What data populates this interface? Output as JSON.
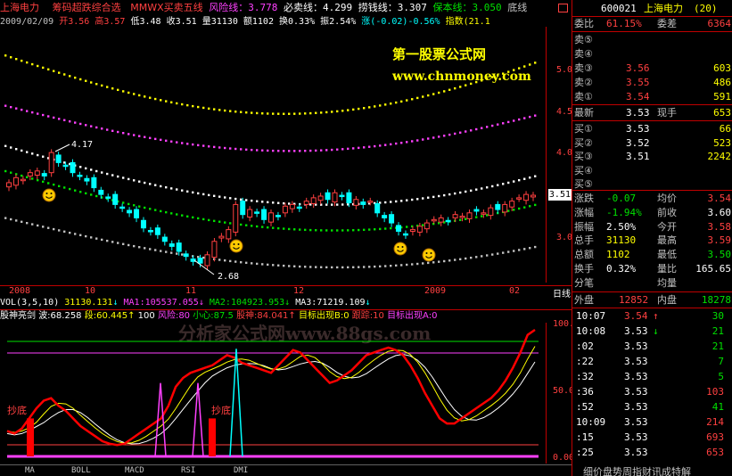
{
  "header": {
    "stock_name": "上海电力",
    "indicator_name": "筹码超跌综合选",
    "indicator_2": "MMWX买卖五线",
    "risk_line_label": "风险线：",
    "risk_line_val": "3.778",
    "sell_label": "必卖线：",
    "sell_val": "4.299",
    "scoop_label": "捞钱线：",
    "scoop_val": "3.307",
    "keep_label": "保本线：",
    "keep_val": "3.050",
    "bottom_label": "底线"
  },
  "ohlc": {
    "date": "2009/02/09",
    "open_label": "开",
    "open": "3.56",
    "high_label": "高",
    "high": "3.57",
    "low_label": "低",
    "low": "3.48",
    "close_label": "收",
    "close": "3.51",
    "vol_label": "量",
    "vol": "31130",
    "amt_label": "额",
    "amt": "1102",
    "turn_label": "换",
    "turn": "0.33%",
    "amp_label": "振",
    "amp": "2.54%",
    "chg_label": "涨",
    "chg": "(-0.02)-0.56%",
    "idx_label": "指数",
    "idx": "(21.1"
  },
  "watermark": {
    "site_name": "第一股票公式网",
    "site_url": "www.chnmoney.com"
  },
  "price_axis": {
    "p500": "5.00",
    "p450": "4.50",
    "p400": "4.00",
    "p350": "3.50",
    "p300": "3.00",
    "current": "3.51"
  },
  "annotations": {
    "high_mark": "4.17",
    "low_mark": "2.68"
  },
  "time_axis": {
    "t2008": "2008",
    "t10": "10",
    "t11": "11",
    "t12": "12",
    "t2009": "2009",
    "t02": "02",
    "period": "日线"
  },
  "vol_line": {
    "label": "VOL(3,5,10)",
    "vol": "31130.131",
    "ma1": "MA1:105537.055",
    "ma2": "MA2:104923.953",
    "ma3": "MA3:71219.109"
  },
  "sub_indicator": {
    "name": "股神亮剑",
    "wave": "波:68.258",
    "seg": "段:60.445",
    "hundred": "100",
    "risk": "风险:80",
    "caution": "小心:87.5",
    "god": "股神:84.041",
    "target_b": "目标出现B:0",
    "track": "跟踪:10",
    "target_a": "目标出现A:0",
    "watermark": "分析家公式网www.88gs.com",
    "axis_100": "100.00",
    "axis_50": "50.00",
    "axis_0": "0.00",
    "bottom_1": "抄底",
    "bottom_2": "抄底"
  },
  "tabs": [
    "MA",
    "BOLL",
    "MACD",
    "RSI",
    "DMI"
  ],
  "panel": {
    "code": "600021",
    "name": "上海电力",
    "bracket": "(20)",
    "weibi_label": "委比",
    "weibi_val": "61.15%",
    "weicha_label": "委差",
    "weicha_val": "6364",
    "sell": [
      {
        "label": "卖⑤",
        "price": "",
        "vol": ""
      },
      {
        "label": "卖④",
        "price": "",
        "vol": ""
      },
      {
        "label": "卖③",
        "price": "3.56",
        "vol": "603"
      },
      {
        "label": "卖②",
        "price": "3.55",
        "vol": "486"
      },
      {
        "label": "卖①",
        "price": "3.54",
        "vol": "591"
      }
    ],
    "latest_label": "最新",
    "latest_val": "3.53",
    "hand_label": "现手",
    "hand_val": "653",
    "buy": [
      {
        "label": "买①",
        "price": "3.53",
        "vol": "66"
      },
      {
        "label": "买②",
        "price": "3.52",
        "vol": "523"
      },
      {
        "label": "买③",
        "price": "3.51",
        "vol": "2242"
      },
      {
        "label": "买④",
        "price": "",
        "vol": ""
      },
      {
        "label": "买⑤",
        "price": "",
        "vol": ""
      }
    ],
    "stats": [
      {
        "l1": "涨跌",
        "v1": "-0.07",
        "l2": "均价",
        "v2": "3.54"
      },
      {
        "l1": "涨幅",
        "v1": "-1.94%",
        "l2": "前收",
        "v2": "3.60"
      },
      {
        "l1": "振幅",
        "v1": "2.50%",
        "l2": "今开",
        "v2": "3.58"
      },
      {
        "l1": "总手",
        "v1": "31130",
        "l2": "最高",
        "v2": "3.59"
      },
      {
        "l1": "总额",
        "v1": "1102",
        "l2": "最低",
        "v2": "3.50"
      },
      {
        "l1": "换手",
        "v1": "0.32%",
        "l2": "量比",
        "v2": "165.65"
      },
      {
        "l1": "分笔",
        "v1": "",
        "l2": "均量",
        "v2": ""
      }
    ],
    "outer_label": "外盘",
    "outer_val": "12852",
    "inner_label": "内盘",
    "inner_val": "18278",
    "ticks": [
      {
        "t": "10:07",
        "p": "3.54",
        "v": "30"
      },
      {
        "t": "10:08",
        "p": "3.53",
        "v": "21"
      },
      {
        "t": ":02",
        "p": "3.53",
        "v": "21"
      },
      {
        "t": ":22",
        "p": "3.53",
        "v": "7"
      },
      {
        "t": ":32",
        "p": "3.53",
        "v": "5"
      },
      {
        "t": ":36",
        "p": "3.53",
        "v": "103"
      },
      {
        "t": ":52",
        "p": "3.53",
        "v": "41"
      },
      {
        "t": "10:09",
        "p": "3.53",
        "v": "214"
      },
      {
        "t": ":15",
        "p": "3.53",
        "v": "693"
      },
      {
        "t": ":25",
        "p": "3.53",
        "v": "653"
      }
    ],
    "footer": "细价盘势周指财讯成特解"
  },
  "colors": {
    "up": "#ff4040",
    "down": "#00ffff",
    "sell_line": "#ff40ff",
    "scoop_line": "#ffffff",
    "keep_line": "#00e000",
    "bottom_line": "#c0c0c0",
    "risk_line": "#ffff00"
  }
}
